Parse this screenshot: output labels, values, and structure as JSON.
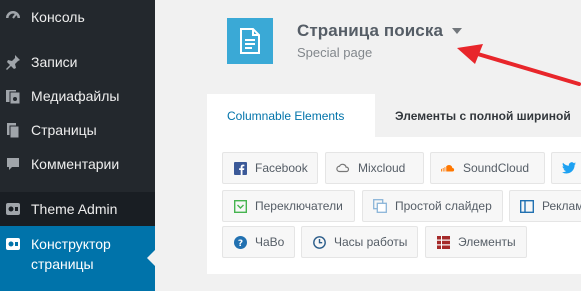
{
  "sidebar": {
    "items": [
      {
        "label": "Консоль",
        "icon": "dashboard-icon"
      },
      {
        "label": "Записи",
        "icon": "pin-icon"
      },
      {
        "label": "Медиафайлы",
        "icon": "media-icon"
      },
      {
        "label": "Страницы",
        "icon": "pages-icon"
      },
      {
        "label": "Комментарии",
        "icon": "comments-icon"
      },
      {
        "label": "Theme Admin",
        "icon": "theme-admin-icon"
      },
      {
        "label_line1": "Конструктор",
        "label_line2": "страницы",
        "icon": "builder-icon"
      }
    ]
  },
  "header": {
    "title": "Страница поиска",
    "subtitle": "Special page",
    "icon": "document-icon"
  },
  "tabs": [
    {
      "label": "Columnable Elements"
    },
    {
      "label": "Элементы с полной шириной"
    }
  ],
  "elements": [
    {
      "label": "Facebook",
      "icon": "facebook-icon"
    },
    {
      "label": "Mixcloud",
      "icon": "cloud-icon"
    },
    {
      "label": "SoundCloud",
      "icon": "soundcloud-icon"
    },
    {
      "label": "",
      "icon": "twitter-icon"
    },
    {
      "label": "Переключатели",
      "icon": "toggle-icon"
    },
    {
      "label": "Простой слайдер",
      "icon": "slider-icon"
    },
    {
      "label": "Реклам",
      "icon": "ad-icon"
    },
    {
      "label": "ЧаВо",
      "icon": "question-icon"
    },
    {
      "label": "Часы работы",
      "icon": "clock-icon"
    },
    {
      "label": "Элементы",
      "icon": "grid-icon"
    }
  ],
  "colors": {
    "sidebar_bg": "#23282d",
    "active_bg": "#0073aa",
    "accent": "#3aa9d6",
    "arrow": "#e8262b"
  }
}
